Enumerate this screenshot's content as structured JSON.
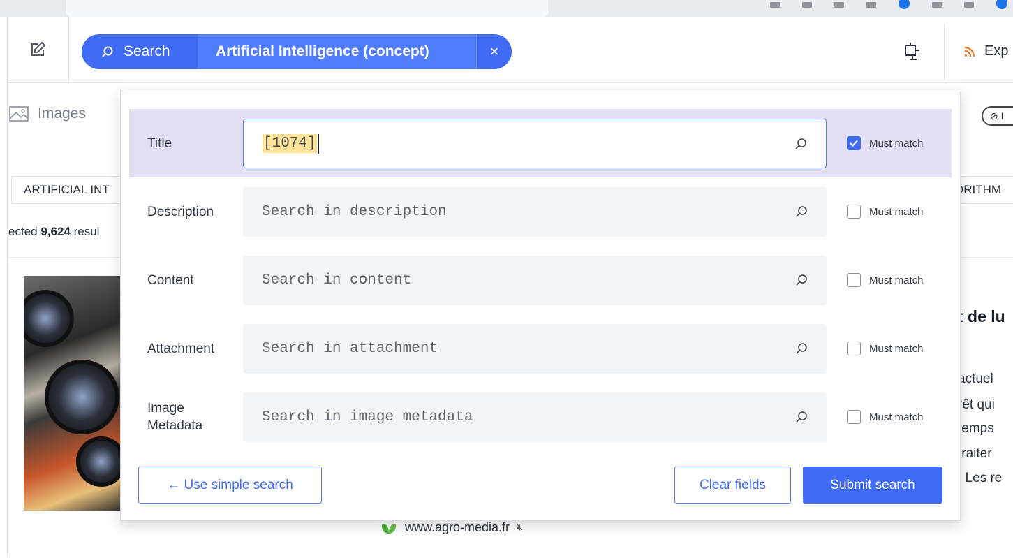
{
  "header": {
    "search_label": "Search",
    "concept_label": "Artificial Intelligence (concept)",
    "close_glyph": "×",
    "rss_label": "Exp"
  },
  "background": {
    "images_tab": "Images",
    "filter_chip": "⊘ I",
    "tag_left": "ARTIFICIAL INT",
    "tag_right": "ORITHM",
    "result_prefix": "ected ",
    "result_count": "9,624",
    "result_suffix": " resul",
    "article_title": "t de lu",
    "article_lines": [
      "actuel",
      "rêt qui",
      "temps",
      "traiter",
      ". Les re"
    ],
    "source": "www.agro-media.fr",
    "mute_glyph": "🔇"
  },
  "advanced": {
    "fields": [
      {
        "label": "Title",
        "value": "[1074]",
        "placeholder": "",
        "must_label": "Must match",
        "checked": true
      },
      {
        "label": "Description",
        "value": "",
        "placeholder": "Search in description",
        "must_label": "Must match",
        "checked": false
      },
      {
        "label": "Content",
        "value": "",
        "placeholder": "Search in content",
        "must_label": "Must match",
        "checked": false
      },
      {
        "label": "Attachment",
        "value": "",
        "placeholder": "Search in attachment",
        "must_label": "Must match",
        "checked": false
      },
      {
        "label": "Image Metadata",
        "value": "",
        "placeholder": "Search in image metadata",
        "must_label": "Must match",
        "checked": false
      }
    ],
    "simple_button": "← Use simple search",
    "clear_button": "Clear fields",
    "submit_button": "Submit search"
  },
  "colors": {
    "accent": "#3f6bf5",
    "active_row": "#e3e0f6",
    "highlight": "#fde49a"
  }
}
